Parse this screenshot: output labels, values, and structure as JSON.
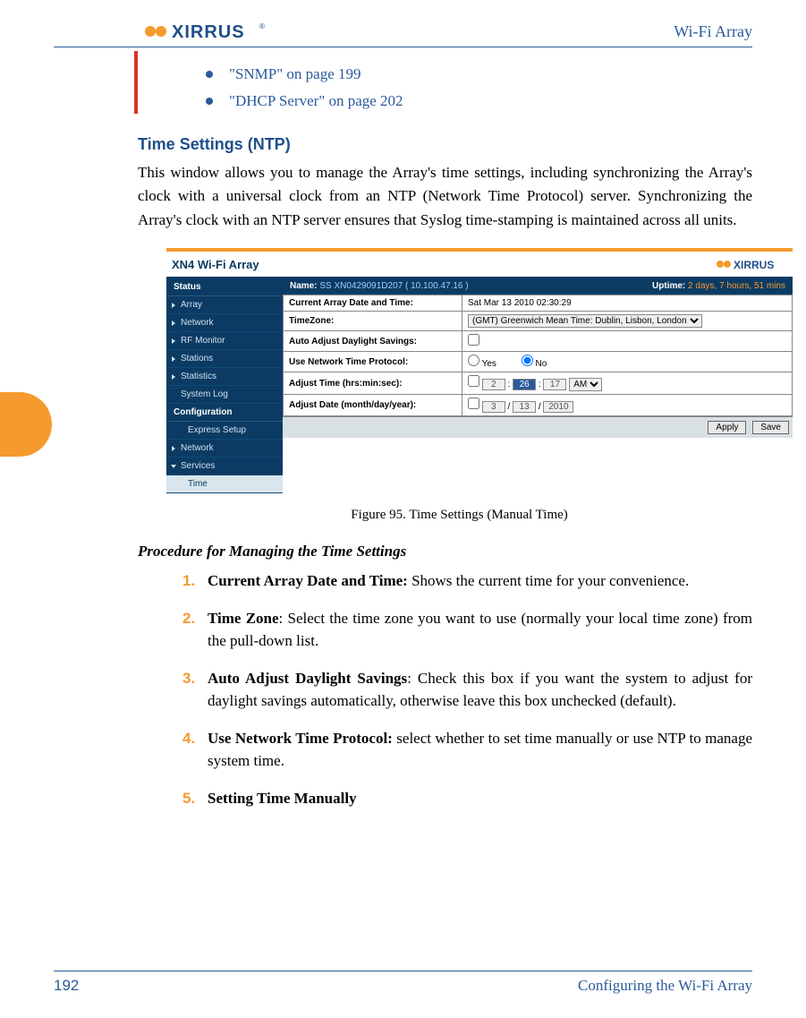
{
  "header": {
    "product": "Wi-Fi Array",
    "logo_text": "XIRRUS"
  },
  "links": {
    "snmp": "\"SNMP\" on page 199",
    "dhcp": "\"DHCP Server\" on page 202"
  },
  "section": {
    "heading": "Time Settings (NTP)",
    "body": "This window allows you to manage the Array's time settings, including synchronizing the Array's clock with a universal clock from an NTP (Network Time Protocol) server. Synchronizing the Array's clock with an NTP server ensures that Syslog time-stamping is maintained across all units."
  },
  "figure": {
    "top_title": "XN4 Wi-Fi Array",
    "logo_text": "XIRRUS",
    "name_label": "Name:",
    "name_value": "SS XN0429091D207   ( 10.100.47.16 )",
    "uptime_label": "Uptime:",
    "uptime_value": "2 days, 7 hours, 51 mins",
    "sidebar": {
      "status": "Status",
      "items": [
        "Array",
        "Network",
        "RF Monitor",
        "Stations",
        "Statistics",
        "System Log"
      ],
      "config": "Configuration",
      "config_items": [
        "Express Setup",
        "Network",
        "Services"
      ],
      "selected": "Time"
    },
    "rows": {
      "datetime_label": "Current Array Date and Time:",
      "datetime_value": "Sat Mar 13 2010 02:30:29",
      "tz_label": "TimeZone:",
      "tz_value": "(GMT) Greenwich Mean Time: Dublin, Lisbon, London",
      "auto_dst_label": "Auto Adjust Daylight Savings:",
      "ntp_label": "Use Network Time Protocol:",
      "ntp_yes": "Yes",
      "ntp_no": "No",
      "adj_time_label": "Adjust Time (hrs:min:sec):",
      "adj_time_h": "2",
      "adj_time_m": "26",
      "adj_time_s": "17",
      "adj_time_ampm": "AM",
      "adj_date_label": "Adjust Date (month/day/year):",
      "adj_date_m": "3",
      "adj_date_d": "13",
      "adj_date_y": "2010"
    },
    "buttons": {
      "apply": "Apply",
      "save": "Save"
    },
    "caption": "Figure 95. Time Settings (Manual Time)"
  },
  "procedure": {
    "heading": "Procedure for Managing the Time Settings",
    "items": [
      {
        "n": "1.",
        "bold": "Current Array Date and Time:",
        "rest": " Shows the current time for your convenience."
      },
      {
        "n": "2.",
        "bold": "Time Zone",
        "rest": ": Select the time zone you want to use (normally your local time zone) from the pull-down list."
      },
      {
        "n": "3.",
        "bold": "Auto Adjust Daylight Savings",
        "rest": ": Check this box if you want the system to adjust for daylight savings automatically, otherwise leave this box unchecked (default)."
      },
      {
        "n": "4.",
        "bold": "Use Network Time Protocol:",
        "rest": " select whether to set time manually or use NTP to manage system time."
      },
      {
        "n": "5.",
        "bold": "Setting Time Manually",
        "rest": ""
      }
    ]
  },
  "footer": {
    "page": "192",
    "section": "Configuring the Wi-Fi Array"
  }
}
